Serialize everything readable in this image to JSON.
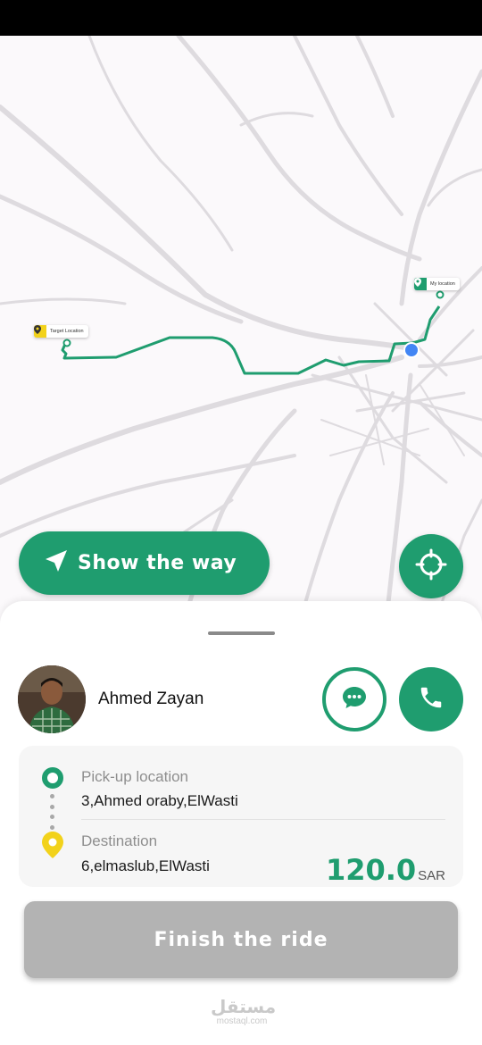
{
  "map": {
    "target_label": "Target Location",
    "my_location_label": "My location"
  },
  "show_way": {
    "label": "Show the way"
  },
  "driver": {
    "name": "Ahmed Zayan"
  },
  "trip": {
    "pickup_label": "Pick-up location",
    "pickup_value": "3,Ahmed oraby,ElWasti",
    "destination_label": "Destination",
    "destination_value": "6,elmaslub,ElWasti",
    "price_amount": "120.0",
    "price_currency": "SAR"
  },
  "finish": {
    "label": "Finish the ride"
  },
  "watermark": {
    "arabic": "مستقل",
    "latin": "mostaql.com"
  },
  "colors": {
    "primary": "#1f9d6f",
    "disabled": "#b3b3b3",
    "user_dot": "#4285f4",
    "target_pin": "#f2d21b"
  },
  "icons": [
    "navigation-arrow-icon",
    "crosshair-icon",
    "chat-bubble-icon",
    "phone-icon",
    "pickup-circle-icon",
    "destination-pin-icon"
  ]
}
